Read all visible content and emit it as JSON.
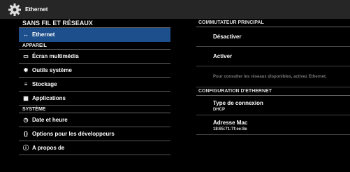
{
  "titlebar": {
    "title": "Ethernet",
    "icon": "gear-icon"
  },
  "sidebar": {
    "sections": [
      {
        "header": "SANS FIL ET RÉSEAUX",
        "items": [
          {
            "label": "Ethernet",
            "icon": "↔",
            "selected": true
          }
        ]
      },
      {
        "header": "APPAREIL",
        "items": [
          {
            "label": "Écran multimédia",
            "icon": "▭"
          },
          {
            "label": "Outils système",
            "icon": "✱"
          },
          {
            "label": "Stockage",
            "icon": "≡"
          },
          {
            "label": "Applications",
            "icon": "▦"
          }
        ]
      },
      {
        "header": "SYSTÈME",
        "items": [
          {
            "label": "Date et heure",
            "icon": "◷"
          },
          {
            "label": "Options pour les développeurs",
            "icon": "{}"
          },
          {
            "label": "A propos de",
            "icon": "ⓘ"
          }
        ]
      }
    ]
  },
  "content": {
    "switch_header": "COMMUTATEUR PRINCIPAL",
    "disable_label": "Désactiver",
    "enable_label": "Activer",
    "hint": "Pour consulter les réseaux disponibles, activez Ethernet.",
    "config_header": "CONFIGURATION D'ETHERNET",
    "connection_type": {
      "label": "Type de connexion",
      "value": "DHCP"
    },
    "mac_address": {
      "label": "Adresse Mac",
      "value": "18:65:71:7f:ee:8e"
    }
  },
  "colors": {
    "selected": "#1d4f8c",
    "titlebar": "#262626",
    "background": "#000000"
  }
}
